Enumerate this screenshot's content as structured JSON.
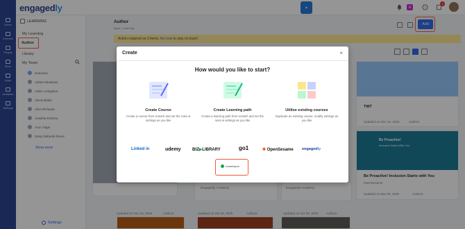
{
  "app": {
    "logo_main": "engaged",
    "logo_accent": "ly",
    "notification_count": "4",
    "profile_badge": "A"
  },
  "rail": {
    "items": [
      "Home",
      "Connect",
      "People",
      "Store",
      "Apps",
      "Analytics",
      "Settings"
    ]
  },
  "sidebar": {
    "header": "LEARNING",
    "my_learning": "My Learning",
    "author": "Author",
    "library": "Library",
    "my_team": "My Team",
    "overview": "Overview",
    "members": [
      "Adrian Meadows",
      "Adam Livingston",
      "Alexis Baker",
      "Alice Richards",
      "Anastha Krishna",
      "Arun Yagar",
      "Daisy Deborah Bruce"
    ],
    "show_more": "Show more",
    "settings": "Settings"
  },
  "header": {
    "title": "Author",
    "breadcrumb": "Apps  >  Learning",
    "add_label": "Add"
  },
  "banner": {
    "text": "Action required on 3 items.",
    "link": "Act now",
    "suffix": "to stay on track!"
  },
  "cards": {
    "c1_title": "TWT",
    "c1_meta": "Updated on Dec 24, 2025",
    "c1_authors": "Authors",
    "c2_title": "Be Proactive! Inclusion Starts with You",
    "c2_sub": "OpenSesame",
    "c2_meta": "Updated on Mar 09, 2025",
    "c2_authors": "Authors",
    "c2_image_line": "Be Proactive!",
    "c2_image_line2": "Inclusion Starts With You",
    "c3_sub": "Engagedly Academy",
    "c3_meta": "Updated on Nov 24, 2025",
    "c3_authors": "Authors",
    "c4_sub": "Engagedly Academy",
    "c4_meta": "Updated on Oct 09, 2025",
    "c4_authors": "Authors",
    "c5_meta": "Updated on Oct 09, 2025",
    "c5_authors": "Authors"
  },
  "modal": {
    "title": "Create",
    "question": "How would you like to start?",
    "options": [
      {
        "title": "Create Course",
        "desc": "Create a course from scratch and set the rules & settings as you like"
      },
      {
        "title": "Create Learning path",
        "desc": "Create a learning path from scratch and set the rules & settings as you like"
      },
      {
        "title": "Utilise existing courses",
        "desc": "Duplicate an existing course, modify settings as you like"
      }
    ],
    "partners": [
      "Linked in",
      "udemy",
      "BIZ",
      "LIBRARY",
      "go1",
      "OpenSesame",
      "engaged",
      "ly"
    ],
    "learning_partner": "LearnUpon"
  },
  "colors": {
    "brand": "#1e3a8a",
    "primary": "#2563eb",
    "highlight": "#ef5a3c",
    "banner": "#fde68a"
  }
}
